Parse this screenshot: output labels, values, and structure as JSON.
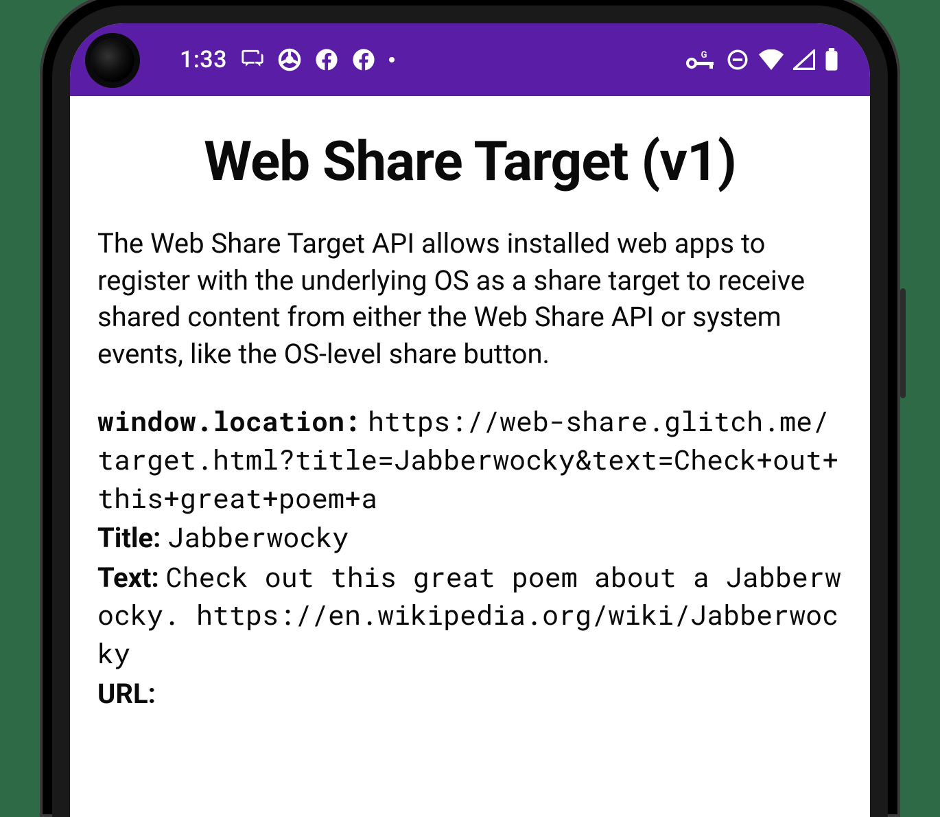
{
  "statusbar": {
    "time": "1:33",
    "accent_color": "#5a1ea6"
  },
  "page": {
    "title": "Web Share Target (v1)",
    "description": "The Web Share Target API allows installed web apps to register with the underlying OS as a share target to receive shared content from either the Web Share API or system events, like the OS-level share button."
  },
  "fields": {
    "location_label": "window.location:",
    "location_value": "https://web-share.glitch.me/target.html?title=Jabberwocky&text=Check+out+this+great+poem+a",
    "title_label": "Title:",
    "title_value": "Jabberwocky",
    "text_label": "Text:",
    "text_value": "Check out this great poem about a Jabberwocky. https://en.wikipedia.org/wiki/Jabberwocky",
    "url_label": "URL:",
    "url_value": ""
  }
}
